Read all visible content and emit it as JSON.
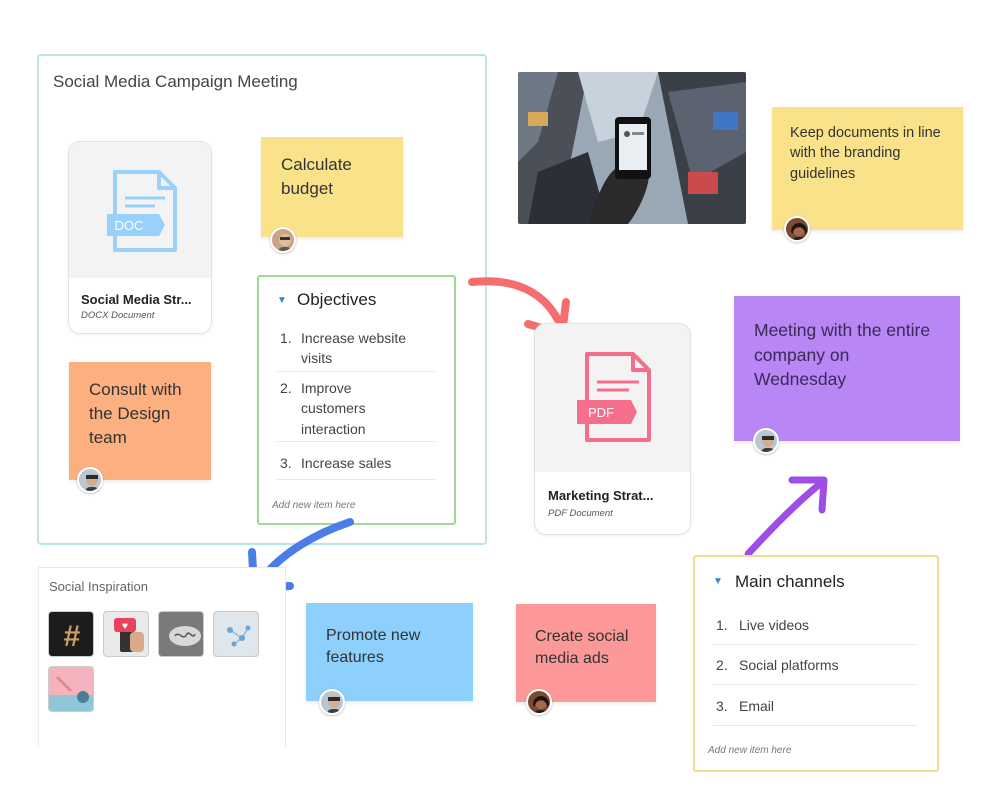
{
  "board": {
    "title": "Social Media Campaign Meeting"
  },
  "doc_card": {
    "badge": "DOC",
    "name": "Social Media Str...",
    "type": "DOCX Document"
  },
  "pdf_card": {
    "badge": "PDF",
    "name": "Marketing Strat...",
    "type": "PDF Document"
  },
  "stickies": {
    "calculate": "Calculate budget",
    "consult": "Consult with the Design team",
    "keep_docs": "Keep documents in line with the branding guidelines",
    "meeting": "Meeting with the entire company on Wednesday",
    "promote": "Promote new features",
    "create_ads": "Create social media ads"
  },
  "objectives": {
    "title": "Objectives",
    "items": [
      {
        "num": "1.",
        "text": "Increase website visits"
      },
      {
        "num": "2.",
        "text": "Improve customers interaction"
      },
      {
        "num": "3.",
        "text": "Increase sales"
      }
    ],
    "add_placeholder": "Add new item here"
  },
  "channels": {
    "title": "Main channels",
    "items": [
      {
        "num": "1.",
        "text": "Live videos"
      },
      {
        "num": "2.",
        "text": "Social platforms"
      },
      {
        "num": "3.",
        "text": "Email"
      }
    ],
    "add_placeholder": "Add new item here"
  },
  "inspiration": {
    "title": "Social Inspiration",
    "thumbs": [
      "hashtag-image",
      "notification-phone-image",
      "handwriting-image",
      "molecule-image",
      "selfie-image"
    ]
  },
  "colors": {
    "yellow_note": "#fae28b",
    "orange_note": "#fcb07f",
    "purple_note": "#b886f5",
    "blue_note": "#8dd0fb",
    "pink_note": "#fd9898",
    "frame_border": "#b6e6e6",
    "objectives_border": "#9fd895",
    "channels_border": "#f6d88e",
    "doc_icon": "#99d1fb",
    "pdf_icon": "#f56f8c",
    "arrow_red": "#f46e6e",
    "arrow_blue": "#4a7de8",
    "arrow_purple": "#9e4de6"
  }
}
